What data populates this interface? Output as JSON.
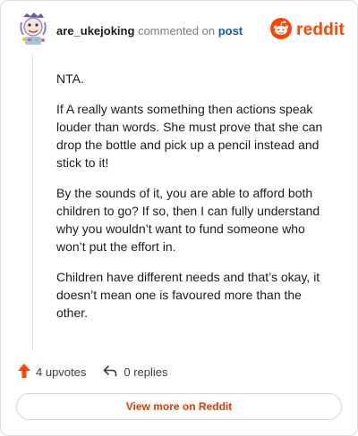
{
  "header": {
    "username": "are_ukejoking",
    "action_text": "commented on",
    "post_link": "post",
    "brand_name": "reddit"
  },
  "comment": {
    "paragraphs": [
      "NTA.",
      "If A really wants something then actions speak louder than words. She must prove that she can drop the bottle and pick up a pencil instead and stick to it!",
      "By the sounds of it, you are able to afford both children to go? If so, then I can fully understand why you wouldn’t want to fund someone who won’t put the effort in.",
      "Children have different needs and that’s okay, it doesn’t mean one is favoured more than the other."
    ]
  },
  "footer": {
    "upvotes": "4 upvotes",
    "replies": "0 replies",
    "view_more": "View more on Reddit"
  },
  "icons": {
    "avatar": "user-avatar",
    "brand_logo": "reddit-snoo-icon",
    "upvote": "upvote-arrow-icon",
    "reply": "reply-arrow-icon"
  },
  "colors": {
    "brand": "#ff4500",
    "upvote": "#ff4500",
    "link": "#0b5bc8",
    "view_more_text": "#d93a00"
  }
}
